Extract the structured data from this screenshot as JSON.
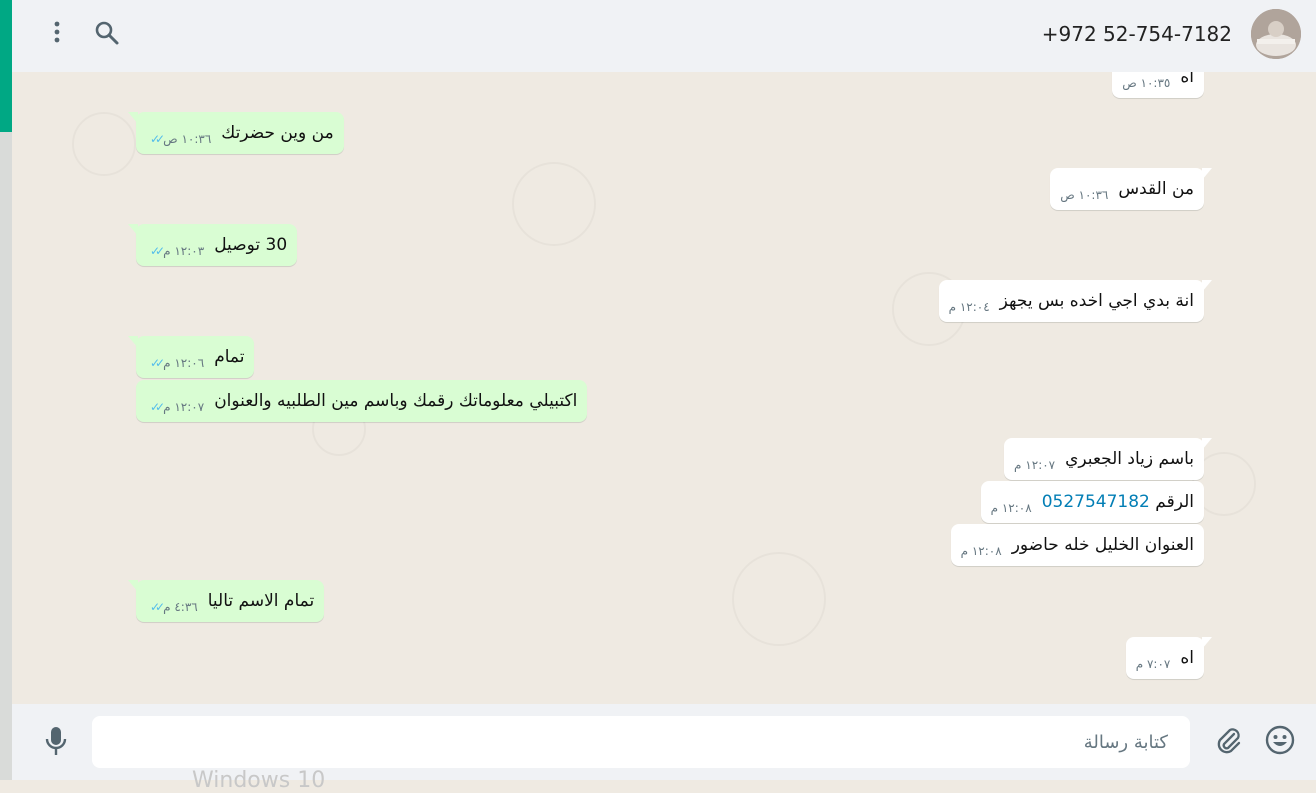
{
  "header": {
    "contact_name": "+972 52-754-7182"
  },
  "messages": [
    {
      "dir": "in",
      "text": "اه",
      "time": "١٠:٣٥ ص"
    },
    {
      "dir": "out",
      "text": "من وين حضرتك",
      "time": "١٠:٣٦ ص"
    },
    {
      "dir": "in",
      "text": "من القدس",
      "time": "١٠:٣٦ ص"
    },
    {
      "dir": "out",
      "text": "30 توصيل",
      "time": "١٢:٠٣ م"
    },
    {
      "dir": "in",
      "text": "انة بدي اجي اخده بس يجهز",
      "time": "١٢:٠٤ م"
    },
    {
      "dir": "out",
      "text": "تمام",
      "time": "١٢:٠٦ م"
    },
    {
      "dir": "out",
      "text": "اكتبيلي معلوماتك رقمك وباسم مين الطلبيه والعنوان",
      "time": "١٢:٠٧ م"
    },
    {
      "dir": "in",
      "text": "باسم زياد الجعبري",
      "time": "١٢:٠٧ م"
    },
    {
      "dir": "in",
      "text": "الرقم",
      "phone": "0527547182",
      "time": "١٢:٠٨ م"
    },
    {
      "dir": "in",
      "text": "العنوان الخليل خله حاضور",
      "time": "١٢:٠٨ م"
    },
    {
      "dir": "out",
      "text": "تمام الاسم تاليا",
      "time": "٤:٣٦ م"
    },
    {
      "dir": "in",
      "text": "اه",
      "time": "٧:٠٧ م"
    }
  ],
  "footer": {
    "placeholder": "كتابة رسالة",
    "watermark": "Windows 10"
  },
  "icons": {
    "menu": "more-vertical-icon",
    "search": "search-icon",
    "mic": "microphone-icon",
    "attach": "paperclip-icon",
    "emoji": "emoji-icon"
  },
  "colors": {
    "accent": "#00a884",
    "outgoing_bubble": "#d9fdd3",
    "incoming_bubble": "#ffffff",
    "chat_bg": "#efeae2",
    "read_ticks": "#53bdeb",
    "phone_link": "#027eb5"
  }
}
